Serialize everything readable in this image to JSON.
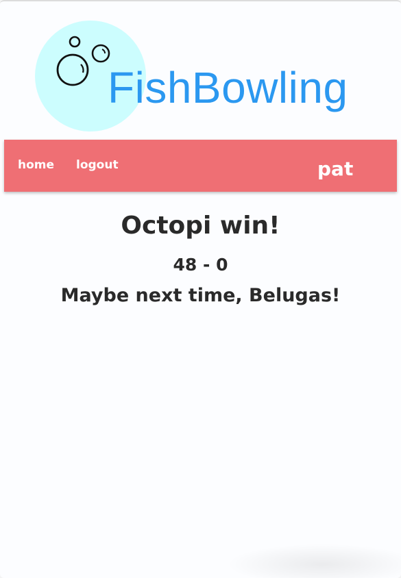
{
  "header": {
    "logo_text": "FishBowling"
  },
  "nav": {
    "home_label": "home",
    "logout_label": "logout",
    "user_name": "pat"
  },
  "result": {
    "title": "Octopi win!",
    "score": "48 - 0",
    "message": "Maybe next time, Belugas!"
  },
  "colors": {
    "logo_circle": "#ccfdfe",
    "logo_text": "#2b98f0",
    "navbar": "#ef6f74",
    "text_dark": "#2a2a2a"
  }
}
